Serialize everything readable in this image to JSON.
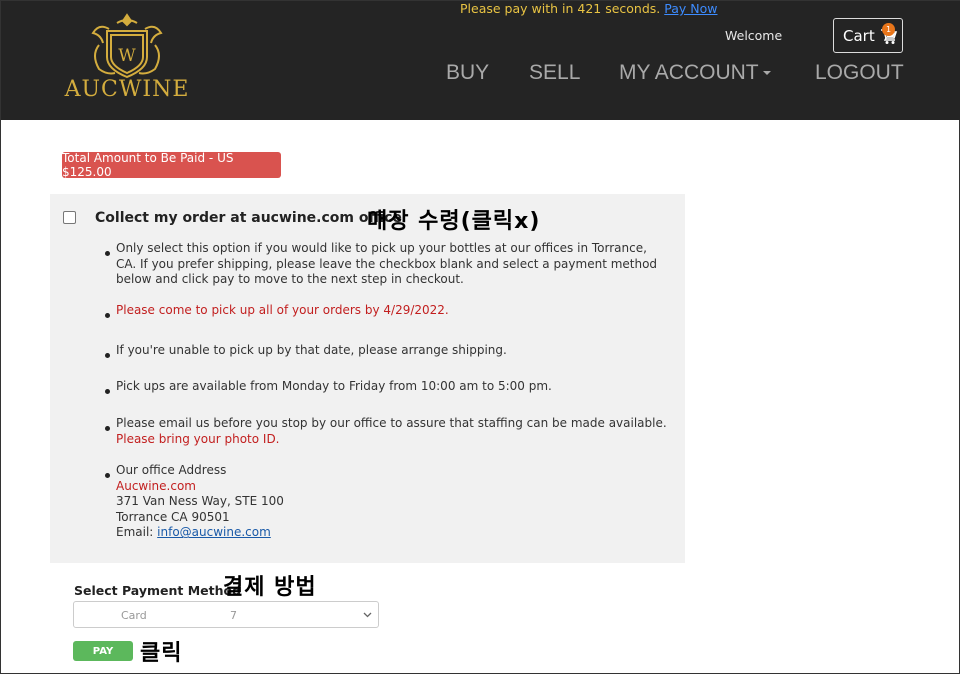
{
  "header": {
    "timer_text": "Please pay with in 421 seconds.",
    "pay_now_link": "Pay Now",
    "logo_text": "AUCWINE",
    "welcome": "Welcome",
    "cart_label": "Cart",
    "cart_count": "1",
    "nav": [
      {
        "label": "BUY"
      },
      {
        "label": "SELL"
      },
      {
        "label": "MY ACCOUNT"
      },
      {
        "label": "LOGOUT"
      }
    ]
  },
  "summary": {
    "total_button": "Total Amount to Be Paid - US $125.00"
  },
  "pickup": {
    "checkbox_label": "Collect my order at aucwine.com office",
    "bullets": [
      {
        "lines": [
          "Only select this option if you would like to pick up your bottles at our offices in Torrance,",
          "CA. If you prefer shipping, please leave the checkbox blank and select a payment method",
          "below and click pay to move to the next step in checkout."
        ]
      },
      {
        "lines": [
          "Please come to pick up all of your orders by 4/29/2022."
        ]
      },
      {
        "lines": [
          "If you're unable to pick up by that date, please arrange shipping."
        ]
      },
      {
        "lines": [
          "Pick ups are available from Monday to Friday from 10:00 am to 5:00 pm."
        ]
      },
      {
        "lines": [
          "Please email us before you stop by our office to assure that staffing can be made available.",
          "Please bring your photo ID."
        ]
      },
      {
        "lines": [
          "Our office Address",
          "Aucwine.com",
          "371 Van Ness Way, STE 100",
          "Torrance CA 90501",
          "Email:",
          "info@aucwine.com"
        ]
      }
    ]
  },
  "payment": {
    "label": "Select Payment Method",
    "select_value_card": "Card",
    "select_value_num": "7",
    "pay_button": "PAY"
  },
  "annotations": {
    "pickup_note": "매장 수령(클릭x)",
    "payment_note": "결제 방법",
    "click_note": "클릭"
  },
  "colors": {
    "header_bg": "#242424",
    "gold": "#d4ad3e",
    "danger": "#d9534f",
    "success": "#5cb85c",
    "red_text": "#c21f1f"
  }
}
